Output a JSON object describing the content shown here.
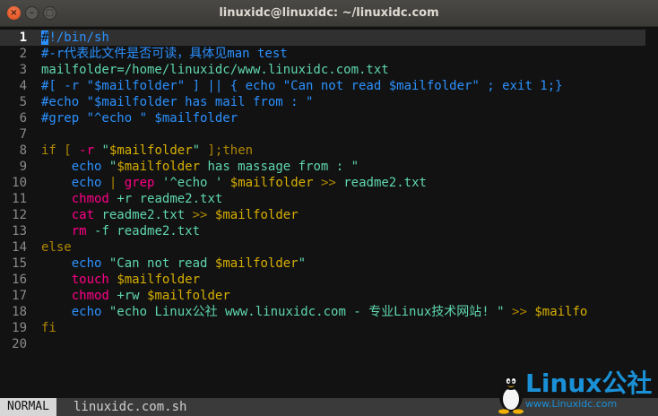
{
  "window": {
    "title": "linuxidc@linuxidc: ~/linuxidc.com",
    "close_glyph": "×",
    "minimize_glyph": "–",
    "maximize_glyph": "□"
  },
  "editor": {
    "current_line": 1,
    "lines": [
      {
        "num": "1",
        "tokens": [
          {
            "c": "cursor",
            "t": "#"
          },
          {
            "c": "cmt",
            "t": "!/bin/sh"
          }
        ]
      },
      {
        "num": "2",
        "tokens": [
          {
            "c": "cmt",
            "t": "#-r代表此文件是否可读，具体见man test"
          }
        ]
      },
      {
        "num": "3",
        "tokens": [
          {
            "c": "str",
            "t": "mailfolder=/home/linuxidc/www.linuxidc.com.txt"
          }
        ]
      },
      {
        "num": "4",
        "tokens": [
          {
            "c": "cmt",
            "t": "#[ -r \"$mailfolder\" ] || { echo \"Can not read $mailfolder\" ; exit 1;}"
          }
        ]
      },
      {
        "num": "5",
        "tokens": [
          {
            "c": "cmt",
            "t": "#echo \"$mailfolder has mail from : \""
          }
        ]
      },
      {
        "num": "6",
        "tokens": [
          {
            "c": "cmt",
            "t": "#grep \"^echo \" $mailfolder"
          }
        ]
      },
      {
        "num": "7",
        "tokens": []
      },
      {
        "num": "8",
        "tokens": [
          {
            "c": "kw",
            "t": "if"
          },
          {
            "c": "txt",
            "t": " "
          },
          {
            "c": "kw",
            "t": "["
          },
          {
            "c": "txt",
            "t": " "
          },
          {
            "c": "red",
            "t": "-r"
          },
          {
            "c": "txt",
            "t": " "
          },
          {
            "c": "str",
            "t": "\""
          },
          {
            "c": "var",
            "t": "$mailfolder"
          },
          {
            "c": "str",
            "t": "\""
          },
          {
            "c": "txt",
            "t": " "
          },
          {
            "c": "kw",
            "t": "];then"
          }
        ]
      },
      {
        "num": "9",
        "tokens": [
          {
            "c": "txt",
            "t": "    "
          },
          {
            "c": "cmd",
            "t": "echo"
          },
          {
            "c": "txt",
            "t": " "
          },
          {
            "c": "str",
            "t": "\""
          },
          {
            "c": "var",
            "t": "$mailfolder"
          },
          {
            "c": "str",
            "t": " has massage from : \""
          }
        ]
      },
      {
        "num": "10",
        "tokens": [
          {
            "c": "txt",
            "t": "    "
          },
          {
            "c": "cmd",
            "t": "echo"
          },
          {
            "c": "txt",
            "t": " "
          },
          {
            "c": "kw",
            "t": "|"
          },
          {
            "c": "txt",
            "t": " "
          },
          {
            "c": "red",
            "t": "grep"
          },
          {
            "c": "txt",
            "t": " "
          },
          {
            "c": "str",
            "t": "'^echo '"
          },
          {
            "c": "txt",
            "t": " "
          },
          {
            "c": "var",
            "t": "$mailfolder"
          },
          {
            "c": "txt",
            "t": " "
          },
          {
            "c": "kw",
            "t": ">>"
          },
          {
            "c": "txt",
            "t": " "
          },
          {
            "c": "str",
            "t": "readme2.txt"
          }
        ]
      },
      {
        "num": "11",
        "tokens": [
          {
            "c": "txt",
            "t": "    "
          },
          {
            "c": "red",
            "t": "chmod"
          },
          {
            "c": "txt",
            "t": " "
          },
          {
            "c": "str",
            "t": "+r readme2.txt"
          }
        ]
      },
      {
        "num": "12",
        "tokens": [
          {
            "c": "txt",
            "t": "    "
          },
          {
            "c": "red",
            "t": "cat"
          },
          {
            "c": "txt",
            "t": " "
          },
          {
            "c": "str",
            "t": "readme2.txt"
          },
          {
            "c": "txt",
            "t": " "
          },
          {
            "c": "kw",
            "t": ">>"
          },
          {
            "c": "txt",
            "t": " "
          },
          {
            "c": "var",
            "t": "$mailfolder"
          }
        ]
      },
      {
        "num": "13",
        "tokens": [
          {
            "c": "txt",
            "t": "    "
          },
          {
            "c": "red",
            "t": "rm"
          },
          {
            "c": "txt",
            "t": " "
          },
          {
            "c": "str",
            "t": "-f readme2.txt"
          }
        ]
      },
      {
        "num": "14",
        "tokens": [
          {
            "c": "kw",
            "t": "else"
          }
        ]
      },
      {
        "num": "15",
        "tokens": [
          {
            "c": "txt",
            "t": "    "
          },
          {
            "c": "cmd",
            "t": "echo"
          },
          {
            "c": "txt",
            "t": " "
          },
          {
            "c": "str",
            "t": "\"Can not read "
          },
          {
            "c": "var",
            "t": "$mailfolder"
          },
          {
            "c": "str",
            "t": "\""
          }
        ]
      },
      {
        "num": "16",
        "tokens": [
          {
            "c": "txt",
            "t": "    "
          },
          {
            "c": "red",
            "t": "touch"
          },
          {
            "c": "txt",
            "t": " "
          },
          {
            "c": "var",
            "t": "$mailfolder"
          }
        ]
      },
      {
        "num": "17",
        "tokens": [
          {
            "c": "txt",
            "t": "    "
          },
          {
            "c": "red",
            "t": "chmod"
          },
          {
            "c": "txt",
            "t": " "
          },
          {
            "c": "str",
            "t": "+rw"
          },
          {
            "c": "txt",
            "t": " "
          },
          {
            "c": "var",
            "t": "$mailfolder"
          }
        ]
      },
      {
        "num": "18",
        "tokens": [
          {
            "c": "txt",
            "t": "    "
          },
          {
            "c": "cmd",
            "t": "echo"
          },
          {
            "c": "txt",
            "t": " "
          },
          {
            "c": "str",
            "t": "\"echo Linux公社 www.linuxidc.com - 专业Linux技术网站! \""
          },
          {
            "c": "txt",
            "t": " "
          },
          {
            "c": "kw",
            "t": ">>"
          },
          {
            "c": "txt",
            "t": " "
          },
          {
            "c": "var",
            "t": "$mailfo"
          }
        ]
      },
      {
        "num": "19",
        "tokens": [
          {
            "c": "kw",
            "t": "fi"
          }
        ]
      },
      {
        "num": "20",
        "tokens": []
      }
    ]
  },
  "statusbar": {
    "mode": "NORMAL",
    "filename": "linuxidc.com.sh"
  },
  "watermark": {
    "brand": "Linux公社",
    "url": "www.Linuxidc.com"
  },
  "colors": {
    "comment": "#2b91ff",
    "string": "#5fd7af",
    "keyword": "#af8700",
    "variable": "#d7af00",
    "command": "#ff0087",
    "background": "#121212"
  }
}
